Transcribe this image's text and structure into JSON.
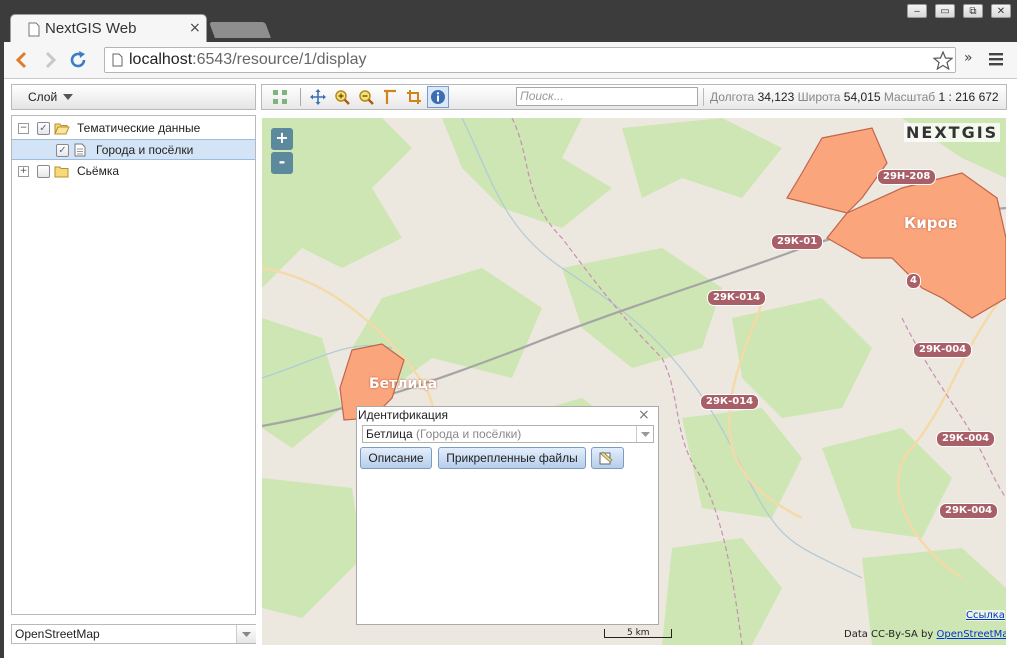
{
  "browser": {
    "tab_title": "NextGIS Web",
    "tab_close": "×",
    "url_host": "localhost",
    "url_rest": ":6543/resource/1/display",
    "extensions_label": "»",
    "window_buttons": [
      "‒",
      "▭",
      "⧉",
      "✕"
    ]
  },
  "layers_panel": {
    "layer_button": "Слой",
    "tree": [
      {
        "label": "Тематические данные",
        "checked": true,
        "expanded": true,
        "type": "folder-open"
      },
      {
        "label": "Города и посёлки",
        "checked": true,
        "selected": true,
        "type": "layer"
      },
      {
        "label": "Сьёмка",
        "checked": false,
        "expanded": false,
        "type": "folder"
      }
    ],
    "basemap": "OpenStreetMap"
  },
  "map_toolbar": {
    "search_placeholder": "Поиск...",
    "lon_label": "Долгота",
    "lon_value": "34,123",
    "lat_label": "Широта",
    "lat_value": "54,015",
    "scale_label": "Масштаб",
    "scale_value": "1 : 216 672"
  },
  "map": {
    "zoom_in": "+",
    "zoom_out": "-",
    "logo": "NEXTGIS",
    "place_labels": [
      "Киров",
      "Бетлица"
    ],
    "road_shields": [
      "29Н-208",
      "29К-01",
      "29К-014",
      "29К-014",
      "29К-004",
      "29К-004",
      "29К-004",
      "4"
    ],
    "scalebar": "5 km",
    "link": "Ссылка",
    "attribution_prefix": "Data CC-By-SA by",
    "attribution_link": "OpenStreetMap",
    "colors": {
      "polygon": "#fba57d",
      "forest": "#cde6b3",
      "background": "#ece8df"
    }
  },
  "popup": {
    "title": "Идентификация",
    "close": "×",
    "feature_name": "Бетлица",
    "feature_layer": "(Города и посёлки)",
    "tab_description": "Описание",
    "tab_attachments": "Прикрепленные файлы"
  }
}
